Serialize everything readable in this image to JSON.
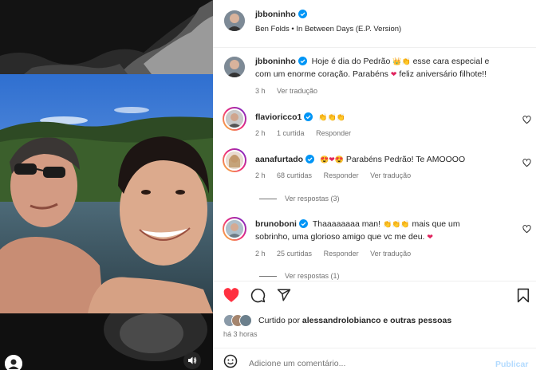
{
  "header": {
    "username": "jbboninho",
    "audio": "Ben Folds • In Between Days (E.P. Version)"
  },
  "caption": {
    "username": "jbboninho",
    "text_part1": "Hoje é dia do Pedrão",
    "text_part2": "esse cara especial e",
    "text_line2a": "com um enorme coração. Parabéns",
    "text_line2b": "feliz aniversário filhote!!",
    "time": "3 h",
    "see_translation": "Ver tradução"
  },
  "comments": [
    {
      "username": "flavioricco1",
      "time": "2 h",
      "likes": "1 curtida",
      "reply": "Responder"
    },
    {
      "username": "aanafurtado",
      "text": "Parabéns Pedrão! Te AMOOOO",
      "time": "2 h",
      "likes": "68 curtidas",
      "reply": "Responder",
      "see_translation": "Ver tradução",
      "view_replies": "Ver respostas (3)"
    },
    {
      "username": "brunoboni",
      "text_line1a": "Thaaaaaaaa man!",
      "text_line1b": "mais que um",
      "text_line2a": "sobrinho, uma glorioso amigo que vc me deu.",
      "time": "2 h",
      "likes": "25 curtidas",
      "reply": "Responder",
      "see_translation": "Ver tradução",
      "view_replies": "Ver respostas (1)"
    }
  ],
  "likes": {
    "text_prefix": "Curtido por",
    "user": "alessandrolobianco",
    "text_suffix": "e outras pessoas",
    "time": "há 3 horas"
  },
  "composer": {
    "placeholder": "Adicione um comentário...",
    "publish": "Publicar"
  },
  "colors": {
    "like_red": "#ff3040",
    "verified_blue": "#0095f6",
    "muted": "#737373"
  },
  "icons": [
    "heart-icon",
    "comment-icon",
    "share-icon",
    "bookmark-icon",
    "emoji-icon",
    "sound-icon",
    "verified-icon"
  ]
}
